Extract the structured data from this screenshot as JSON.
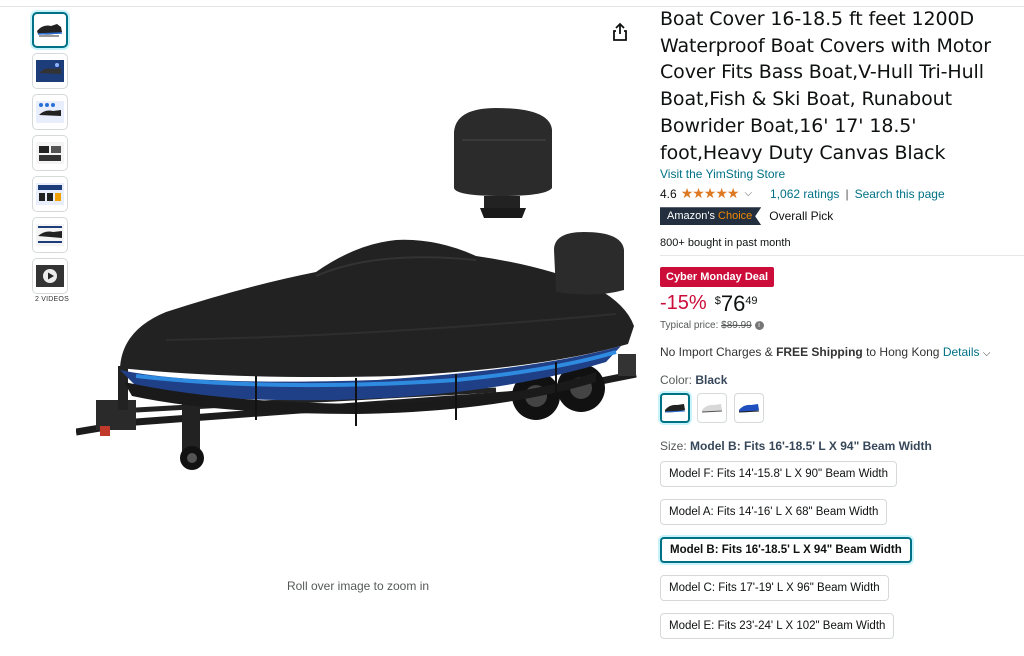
{
  "gallery": {
    "videos_label": "2 VIDEOS",
    "zoom_hint": "Roll over image to zoom in"
  },
  "product": {
    "title": "Boat Cover 16-18.5 ft feet 1200D Waterproof Boat Covers with Motor Cover Fits Bass Boat,V-Hull Tri-Hull Boat,Fish & Ski Boat, Runabout Bowrider Boat,16' 17' 18.5' foot,Heavy Duty Canvas Black",
    "store_link": "Visit the YimSting Store",
    "rating": "4.6",
    "stars": "★★★★★",
    "ratings_count": "1,062 ratings",
    "separator": "|",
    "search_page": "Search this page",
    "badge_prefix": "Amazon's",
    "badge_suffix": "Choice",
    "badge_text": "Overall Pick",
    "bought": "800+ bought in past month"
  },
  "price": {
    "deal_label": "Cyber Monday Deal",
    "discount": "-15%",
    "currency": "$",
    "whole": "76",
    "fraction": "49",
    "typical_label": "Typical price:",
    "typical_value": "$89.99"
  },
  "shipping": {
    "prefix": "No Import Charges &",
    "bold": "FREE Shipping",
    "to": "to Hong Kong",
    "details": "Details"
  },
  "color": {
    "label": "Color:",
    "value": "Black"
  },
  "size": {
    "label": "Size:",
    "value": "Model B: Fits 16'-18.5' L X 94\" Beam Width",
    "options": [
      "Model F: Fits 14'-15.8' L X 90\" Beam Width",
      "Model A: Fits 14'-16' L X 68\" Beam Width",
      "Model B: Fits 16'-18.5' L X 94\" Beam Width",
      "Model C: Fits 17'-19' L X 96\" Beam Width",
      "Model E: Fits 23'-24' L X 102\" Beam Width"
    ]
  },
  "colors": {
    "link": "#007185",
    "deal_red": "#cc0c39",
    "star_orange": "#de7921",
    "badge_navy": "#232f3e"
  }
}
